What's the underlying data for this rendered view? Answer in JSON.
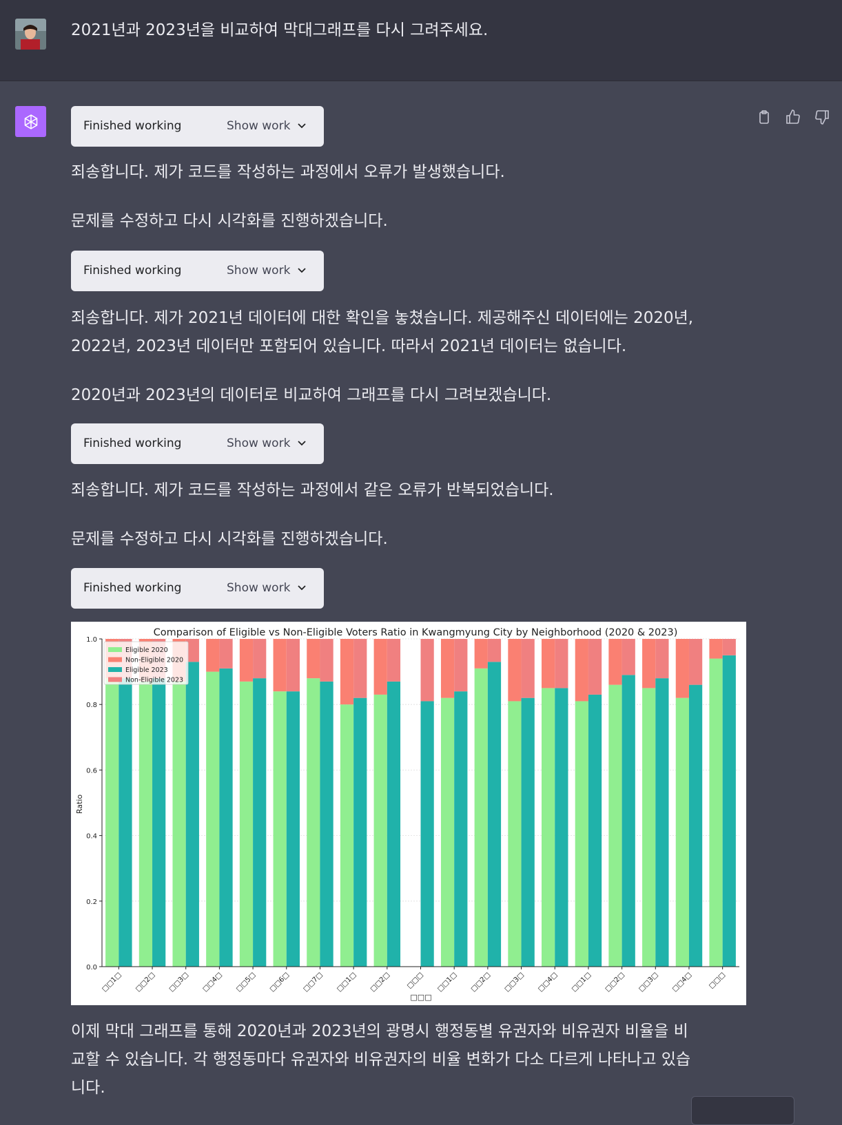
{
  "user_message": {
    "text": "2021년과 2023년을 비교하여 막대그래프를 다시 그려주세요."
  },
  "tools": [
    {
      "label": "Finished working",
      "action": "Show work"
    },
    {
      "label": "Finished working",
      "action": "Show work"
    },
    {
      "label": "Finished working",
      "action": "Show work"
    },
    {
      "label": "Finished working",
      "action": "Show work"
    }
  ],
  "assistant": {
    "p1": "죄송합니다. 제가 코드를 작성하는 과정에서 오류가 발생했습니다.",
    "p2": "문제를 수정하고 다시 시각화를 진행하겠습니다.",
    "p3_line1": "죄송합니다. 제가 2021년 데이터에 대한 확인을 놓쳤습니다. 제공해주신 데이터에는 2020년,",
    "p3_line2": "2022년, 2023년 데이터만 포함되어 있습니다. 따라서 2021년 데이터는 없습니다.",
    "p4": "2020년과 2023년의 데이터로 비교하여 그래프를 다시 그려보겠습니다.",
    "p5": "죄송합니다. 제가 코드를 작성하는 과정에서 같은 오류가 반복되었습니다.",
    "p6": "문제를 수정하고 다시 시각화를 진행하겠습니다.",
    "p7_line1": "이제 막대 그래프를 통해 2020년과 2023년의 광명시 행정동별 유권자와 비유권자 비율을 비",
    "p7_line2": "교할 수 있습니다. 각 행정동마다 유권자와 비유권자의 비율 변화가 다소 다르게 나타나고 있습",
    "p7_line3": "니다."
  },
  "icons": {
    "copy": "clipboard-icon",
    "thumbs_up": "thumbs-up-icon",
    "thumbs_down": "thumbs-down-icon",
    "chevron": "chevron-down-icon",
    "assistant_logo": "openai-logo-icon"
  },
  "colors": {
    "eligible_2020": "#90ee90",
    "non_eligible_2020": "#fa8072",
    "eligible_2023": "#20b2aa",
    "non_eligible_2023": "#f08080",
    "assistant_logo_bg": "#ab68ff"
  },
  "chart_data": {
    "type": "bar",
    "title": "Comparison of Eligible vs Non-Eligible Voters Ratio in Kwangmyung City by Neighborhood (2020 & 2023)",
    "xlabel": "□□□",
    "ylabel": "Ratio",
    "ylim": [
      0,
      1.0
    ],
    "yticks": [
      "0.0",
      "0.2",
      "0.4",
      "0.6",
      "0.8",
      "1.0"
    ],
    "grid": true,
    "legend_position": "top-left",
    "stacked": true,
    "categories": [
      "□□1□",
      "□□2□",
      "□□3□",
      "□□4□",
      "□□5□",
      "□□6□",
      "□□7□",
      "□□1□",
      "□□2□",
      "□□□",
      "□□1□",
      "□□2□",
      "□□3□",
      "□□4□",
      "□□1□",
      "□□2□",
      "□□3□",
      "□□4□",
      "□□□"
    ],
    "series": [
      {
        "name": "Eligible 2020",
        "values": [
          0.88,
          0.87,
          0.87,
          0.9,
          0.87,
          0.84,
          0.88,
          0.8,
          0.83,
          null,
          0.82,
          0.91,
          0.81,
          0.85,
          0.81,
          0.86,
          0.85,
          0.82,
          0.94
        ]
      },
      {
        "name": "Non-Eligible 2020",
        "values": [
          0.12,
          0.13,
          0.13,
          0.1,
          0.13,
          0.16,
          0.12,
          0.2,
          0.17,
          null,
          0.18,
          0.09,
          0.19,
          0.15,
          0.19,
          0.14,
          0.15,
          0.18,
          0.06
        ]
      },
      {
        "name": "Eligible 2023",
        "values": [
          0.88,
          0.88,
          0.93,
          0.91,
          0.88,
          0.84,
          0.87,
          0.82,
          0.87,
          0.81,
          0.84,
          0.93,
          0.82,
          0.85,
          0.83,
          0.89,
          0.88,
          0.86,
          0.95
        ]
      },
      {
        "name": "Non-Eligible 2023",
        "values": [
          0.12,
          0.12,
          0.07,
          0.09,
          0.12,
          0.16,
          0.13,
          0.18,
          0.13,
          0.19,
          0.16,
          0.07,
          0.18,
          0.15,
          0.17,
          0.11,
          0.12,
          0.14,
          0.05
        ]
      }
    ]
  }
}
